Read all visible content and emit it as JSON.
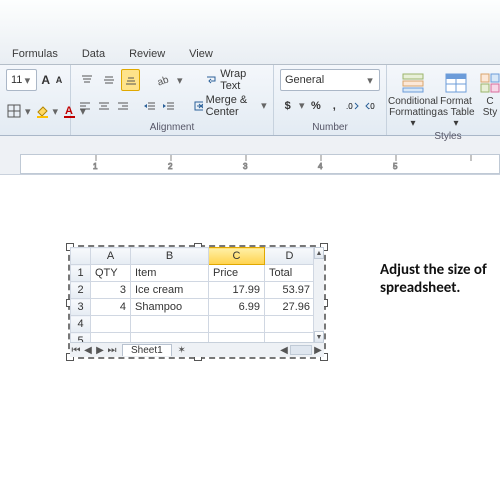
{
  "ribbon": {
    "tabs": [
      "Formulas",
      "Data",
      "Review",
      "View"
    ],
    "font_size": "11",
    "wrap_text": "Wrap Text",
    "merge_center": "Merge & Center",
    "number_format": "General",
    "cond_fmt_line1": "Conditional",
    "cond_fmt_line2": "Formatting",
    "fmt_table_line1": "Format",
    "fmt_table_line2": "as Table",
    "cell_styles_line1": "C",
    "cell_styles_line2": "Sty",
    "group_alignment": "Alignment",
    "group_number": "Number",
    "group_styles": "Styles"
  },
  "spreadsheet": {
    "cols": [
      "A",
      "B",
      "C",
      "D"
    ],
    "selected_col_index": 2,
    "row_headers": [
      "1",
      "2",
      "3",
      "4",
      "5"
    ],
    "rows": [
      {
        "a": "QTY",
        "b": "Item",
        "c": "Price",
        "d": "Total"
      },
      {
        "a": "3",
        "b": "Ice cream",
        "c": "17.99",
        "d": "53.97"
      },
      {
        "a": "4",
        "b": "Shampoo",
        "c": "6.99",
        "d": "27.96"
      },
      {
        "a": "",
        "b": "",
        "c": "",
        "d": ""
      },
      {
        "a": "",
        "b": "",
        "c": "",
        "d": ""
      }
    ],
    "sheet_tab": "Sheet1"
  },
  "instruction": {
    "line1": "Adjust the size of",
    "line2": "spreadsheet."
  },
  "chart_data": {
    "type": "table",
    "headers": [
      "QTY",
      "Item",
      "Price",
      "Total"
    ],
    "rows": [
      [
        3,
        "Ice cream",
        17.99,
        53.97
      ],
      [
        4,
        "Shampoo",
        6.99,
        27.96
      ]
    ]
  }
}
